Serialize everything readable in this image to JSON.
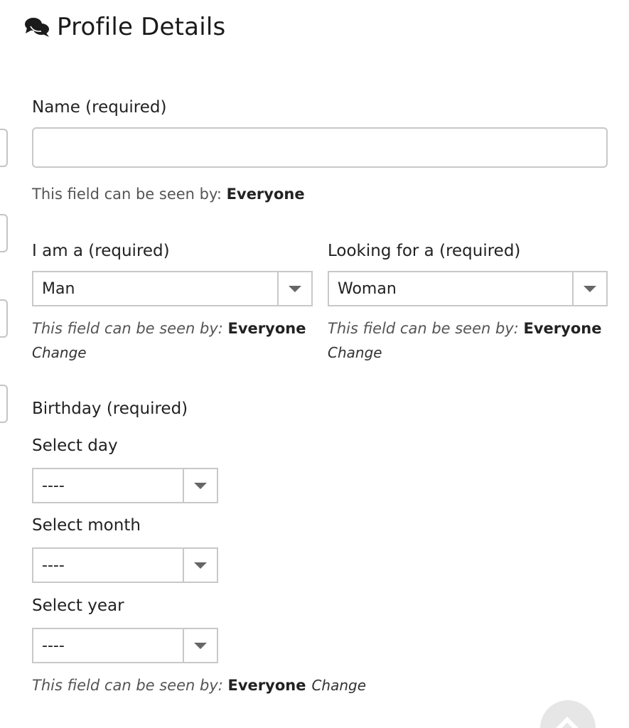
{
  "header": {
    "title": "Profile Details",
    "icon": "comments-icon"
  },
  "name_field": {
    "label": "Name (required)",
    "value": "",
    "visibility_prefix": "This field can be seen by: ",
    "visibility_value": "Everyone"
  },
  "iam_field": {
    "label": "I am a (required)",
    "selected": "Man",
    "visibility_prefix": "This field can be seen by: ",
    "visibility_value": "Everyone",
    "change_label": "Change"
  },
  "looking_field": {
    "label": "Looking for a (required)",
    "selected": "Woman",
    "visibility_prefix": "This field can be seen by: ",
    "visibility_value": "Everyone",
    "change_label": "Change"
  },
  "birthday": {
    "label": "Birthday (required)",
    "day": {
      "label": "Select day",
      "selected": "----"
    },
    "month": {
      "label": "Select month",
      "selected": "----"
    },
    "year": {
      "label": "Select year",
      "selected": "----"
    },
    "visibility_prefix": "This field can be seen by: ",
    "visibility_value": "Everyone",
    "change_label": "Change"
  }
}
